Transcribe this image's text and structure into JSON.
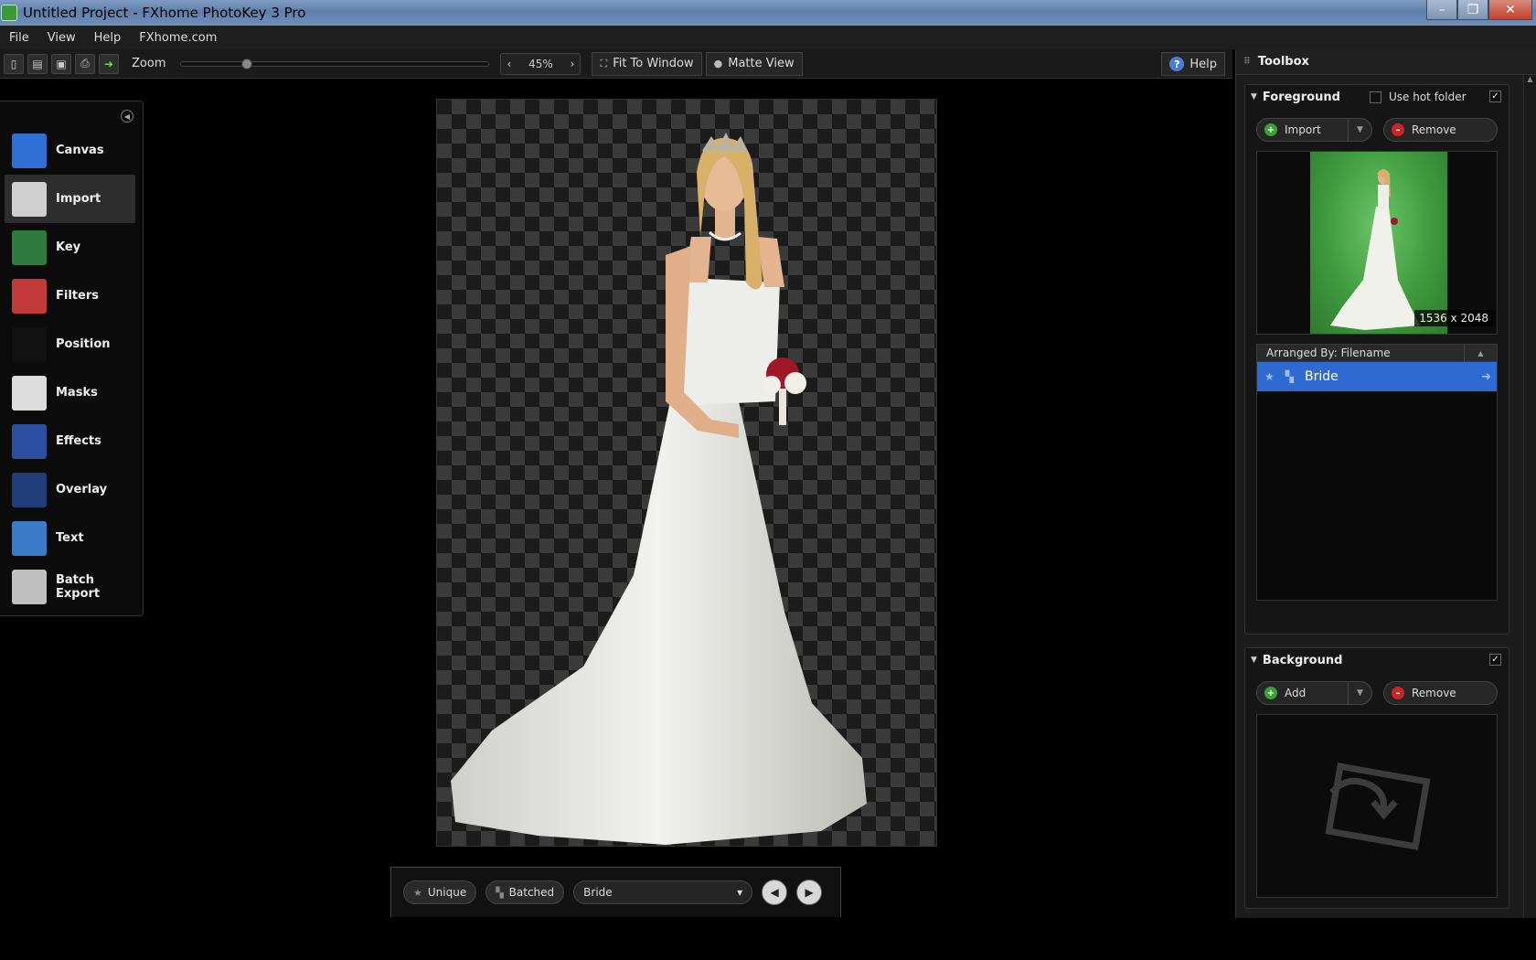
{
  "window": {
    "title": "Untitled Project - FXhome PhotoKey 3 Pro",
    "minimize": "–",
    "maximize": "❐",
    "close": "✕"
  },
  "menu": [
    "File",
    "View",
    "Help",
    "FXhome.com"
  ],
  "toolbar": {
    "icons": [
      "new-file-icon",
      "open-file-icon",
      "save-icon",
      "print-icon",
      "export-arrow-icon"
    ],
    "zoom_label": "Zoom",
    "zoom_value": "45%",
    "zoom_fraction": 0.2,
    "fit_to_window": "Fit To Window",
    "matte_view": "Matte View",
    "help": "Help"
  },
  "tools": [
    {
      "label": "Canvas",
      "icon": "canvas-icon",
      "color": "#2f6fd6"
    },
    {
      "label": "Import",
      "icon": "camera-icon",
      "color": "#cfcfcf",
      "active": true
    },
    {
      "label": "Key",
      "icon": "face-icon",
      "color": "#2f7a3f"
    },
    {
      "label": "Filters",
      "icon": "sliders-icon",
      "color": "#c33a3a"
    },
    {
      "label": "Position",
      "icon": "position-icon",
      "color": "#111111"
    },
    {
      "label": "Masks",
      "icon": "theater-masks-icon",
      "color": "#dddddd"
    },
    {
      "label": "Effects",
      "icon": "magic-wand-icon",
      "color": "#2a4fa0"
    },
    {
      "label": "Overlay",
      "icon": "overlay-poster-icon",
      "color": "#1f3e7a"
    },
    {
      "label": "Text",
      "icon": "text-t-icon",
      "color": "#3a7bc8"
    },
    {
      "label": "Batch Export",
      "icon": "hard-drive-icon",
      "color": "#bfbfbf"
    }
  ],
  "bottombar": {
    "unique": "Unique",
    "batched": "Batched",
    "selected": "Bride"
  },
  "toolbox": {
    "title": "Toolbox",
    "foreground": {
      "title": "Foreground",
      "hot_folder": "Use hot folder",
      "import": "Import",
      "remove": "Remove",
      "dimensions": "1536 x 2048",
      "arranged_by": "Arranged By: Filename",
      "items": [
        "Bride"
      ]
    },
    "background": {
      "title": "Background",
      "add": "Add",
      "remove": "Remove"
    }
  }
}
